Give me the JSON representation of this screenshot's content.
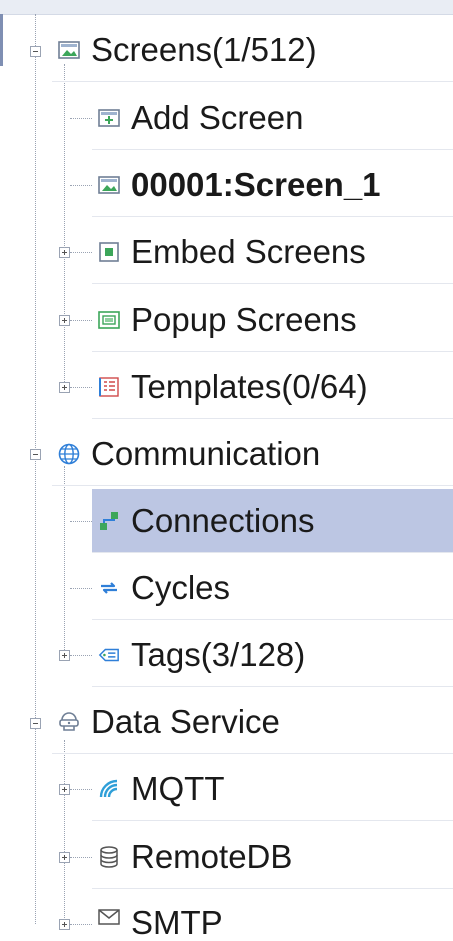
{
  "tree": {
    "screens": {
      "label": "Screens(1/512)",
      "expanded": true,
      "icon": "screens-icon"
    },
    "add_screen": {
      "label": "Add Screen",
      "icon": "add-screen-icon"
    },
    "screen_1": {
      "label": "00001:Screen_1",
      "icon": "screen-icon"
    },
    "embed_screens": {
      "label": "Embed Screens",
      "expanded": false,
      "icon": "embed-screens-icon"
    },
    "popup_screens": {
      "label": "Popup Screens",
      "expanded": false,
      "icon": "popup-screens-icon"
    },
    "templates": {
      "label": "Templates(0/64)",
      "expanded": false,
      "icon": "templates-icon"
    },
    "communication": {
      "label": "Communication",
      "expanded": true,
      "icon": "globe-icon"
    },
    "connections": {
      "label": "Connections",
      "selected": true,
      "icon": "connections-icon"
    },
    "cycles": {
      "label": "Cycles",
      "icon": "cycles-icon"
    },
    "tags": {
      "label": "Tags(3/128)",
      "expanded": false,
      "icon": "tags-icon"
    },
    "data_service": {
      "label": "Data Service",
      "expanded": true,
      "icon": "data-service-icon"
    },
    "mqtt": {
      "label": "MQTT",
      "expanded": false,
      "icon": "mqtt-icon"
    },
    "remotedb": {
      "label": "RemoteDB",
      "expanded": false,
      "icon": "database-icon"
    },
    "smtp": {
      "label": "SMTP",
      "expanded": false,
      "icon": "mail-icon"
    }
  },
  "colors": {
    "selection": "#bcc6e3",
    "accent_green": "#3ca65a",
    "accent_blue": "#2f7fd8"
  }
}
